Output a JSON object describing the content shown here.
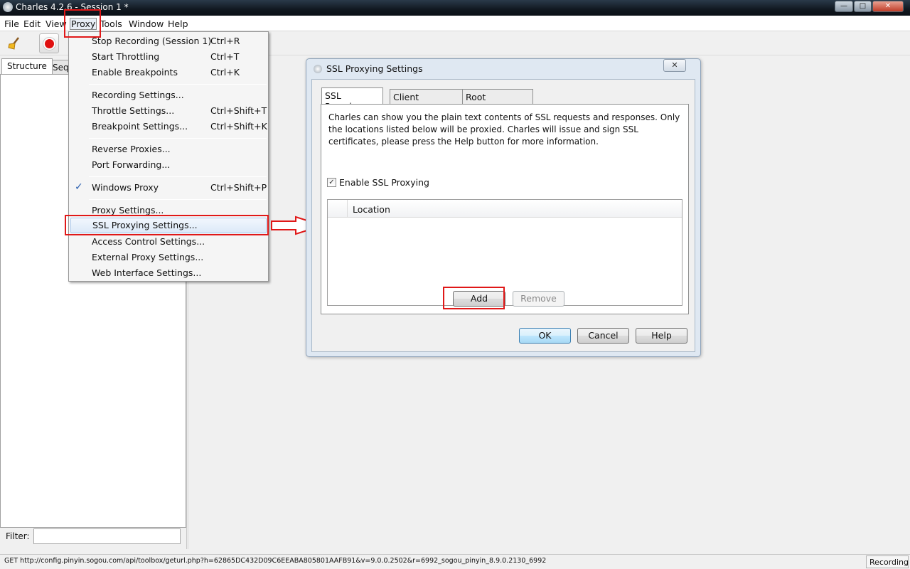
{
  "window": {
    "title": "Charles 4.2.6 - Session 1 *",
    "controls": {
      "minimize": "—",
      "maximize": "□",
      "close": "✕"
    }
  },
  "menubar": {
    "items": [
      "File",
      "Edit",
      "View",
      "Proxy",
      "Tools",
      "Window",
      "Help"
    ]
  },
  "toolbar": {
    "icons": [
      "broom-icon",
      "record-icon"
    ]
  },
  "left_panel": {
    "tabs": [
      "Structure",
      "Sequ"
    ],
    "filter_label": "Filter:",
    "filter_value": ""
  },
  "proxy_menu": {
    "items": [
      {
        "label": "Stop Recording (Session 1)",
        "shortcut": "Ctrl+R"
      },
      {
        "label": "Start Throttling",
        "shortcut": "Ctrl+T"
      },
      {
        "label": "Enable Breakpoints",
        "shortcut": "Ctrl+K"
      },
      {
        "label": "Recording Settings...",
        "shortcut": ""
      },
      {
        "label": "Throttle Settings...",
        "shortcut": "Ctrl+Shift+T"
      },
      {
        "label": "Breakpoint Settings...",
        "shortcut": "Ctrl+Shift+K"
      },
      {
        "label": "Reverse Proxies...",
        "shortcut": ""
      },
      {
        "label": "Port Forwarding...",
        "shortcut": ""
      },
      {
        "label": "Windows Proxy",
        "shortcut": "Ctrl+Shift+P",
        "checked": true
      },
      {
        "label": "Proxy Settings...",
        "shortcut": ""
      },
      {
        "label": "SSL Proxying Settings...",
        "shortcut": ""
      },
      {
        "label": "Access Control Settings...",
        "shortcut": ""
      },
      {
        "label": "External Proxy Settings...",
        "shortcut": ""
      },
      {
        "label": "Web Interface Settings...",
        "shortcut": ""
      }
    ]
  },
  "dialog": {
    "title": "SSL Proxying Settings",
    "close_label": "✕",
    "tabs": [
      "SSL Proxying",
      "Client Certificates",
      "Root Certificate"
    ],
    "description": "Charles can show you the plain text contents of SSL requests and responses. Only the locations listed below will be proxied. Charles will issue and sign SSL certificates, please press the Help button for more information.",
    "enable_label": "Enable SSL Proxying",
    "enable_checked": true,
    "table_header": "Location",
    "add_label": "Add",
    "remove_label": "Remove",
    "ok_label": "OK",
    "cancel_label": "Cancel",
    "help_label": "Help"
  },
  "statusbar": {
    "url": "GET http://config.pinyin.sogou.com/api/toolbox/geturl.php?h=62865DC432D09C6EEABA805801AAFB91&v=9.0.0.2502&r=6992_sogou_pinyin_8.9.0.2130_6992",
    "status": "Recording"
  },
  "colors": {
    "highlight_red": "#e01818",
    "record_red": "#e01010",
    "check_blue": "#2a5fb0"
  }
}
